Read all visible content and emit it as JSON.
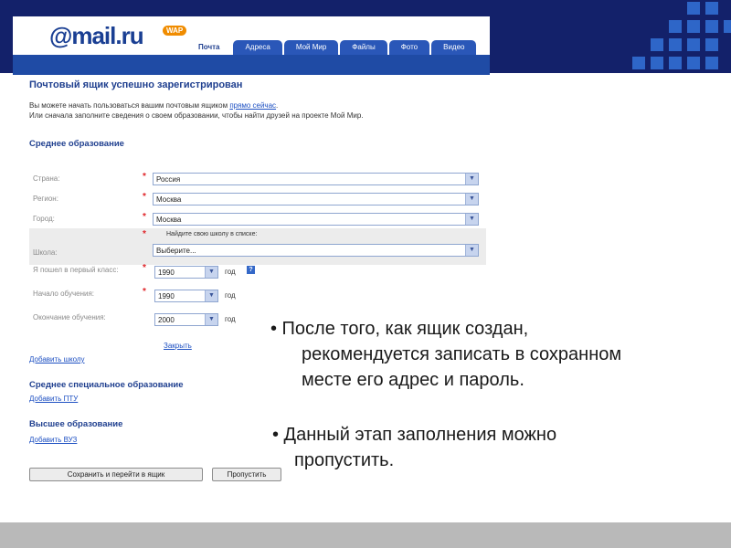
{
  "app": {
    "logo_text": "@mail.ru",
    "wap_badge": "WAP",
    "tabs": [
      "Почта",
      "Адреса",
      "Мой Мир",
      "Файлы",
      "Фото",
      "Видео"
    ]
  },
  "page": {
    "title": "Почтовый ящик успешно зарегистрирован",
    "intro_prefix": "Вы можете начать пользоваться вашим почтовым ящиком ",
    "intro_link": "прямо сейчас",
    "intro_suffix": ".",
    "intro_line2": "Или сначала заполните сведения о своем образовании, чтобы найти друзей на проекте Мой Мир."
  },
  "secondary": {
    "heading": "Среднее образование",
    "required_mark": "*",
    "fields": {
      "country": {
        "label": "Страна:",
        "value": "Россия"
      },
      "region": {
        "label": "Регион:",
        "value": "Москва"
      },
      "city": {
        "label": "Город:",
        "value": "Москва"
      },
      "school_hint": "Найдите свою школу в списке:",
      "school": {
        "label": "Школа:",
        "value": "Выберите..."
      },
      "first_grade": {
        "label": "Я пошел в первый класс:",
        "value": "1990",
        "unit": "год"
      },
      "start": {
        "label": "Начало обучения:",
        "value": "1990",
        "unit": "год"
      },
      "end": {
        "label": "Окончание обучения:",
        "value": "2000",
        "unit": "год"
      }
    },
    "help_icon": "?",
    "close_link": "Закрыть",
    "add_school_link": "Добавить школу"
  },
  "vocational": {
    "heading": "Среднее специальное образование",
    "add_link": "Добавить ПТУ"
  },
  "higher": {
    "heading": "Высшее образование",
    "add_link": "Добавить ВУЗ"
  },
  "buttons": {
    "save": "Сохранить и перейти в ящик",
    "skip": "Пропустить"
  },
  "bullets": {
    "b1_line1": "• После того, как ящик создан,",
    "b1_line2": "рекомендуется записать в сохранном",
    "b1_line3": "месте  его адрес и пароль.",
    "b2_line1": "• Данный этап заполнения можно",
    "b2_line2": "пропустить."
  },
  "icons": {
    "dropdown_arrow": "chevron-down-icon",
    "help": "help-icon"
  },
  "colors": {
    "frame_navy": "#13216a",
    "pixel_blue": "#2e66c8",
    "link_blue": "#1c4fc2",
    "required_red": "#e0262a"
  }
}
